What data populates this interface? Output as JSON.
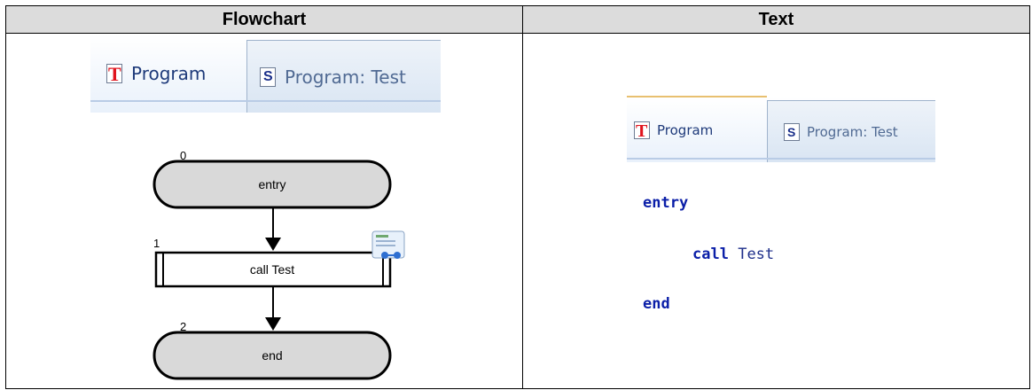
{
  "table": {
    "headers": [
      "Flowchart",
      "Text"
    ]
  },
  "flowchart_panel": {
    "tabs": [
      {
        "label": "Program",
        "icon": "t-document-icon",
        "active": true
      },
      {
        "label": "Program: Test",
        "icon": "s-document-icon",
        "active": false
      }
    ],
    "nodes": [
      {
        "index": "0",
        "label": "entry",
        "shape": "terminal"
      },
      {
        "index": "1",
        "label": "call Test",
        "shape": "subroutine"
      },
      {
        "index": "2",
        "label": "end",
        "shape": "terminal"
      }
    ]
  },
  "text_panel": {
    "tabs": [
      {
        "label": "Program",
        "icon": "t-document-icon",
        "active": true
      },
      {
        "label": "Program: Test",
        "icon": "s-document-icon",
        "active": false
      }
    ],
    "code": {
      "entry_keyword": "entry",
      "call_keyword": "call",
      "call_target": "Test",
      "end_keyword": "end"
    }
  },
  "colors": {
    "keyword": "#0b1fa8",
    "terminal_fill": "#d9d9d9",
    "tab_text": "#1e3a7a"
  }
}
